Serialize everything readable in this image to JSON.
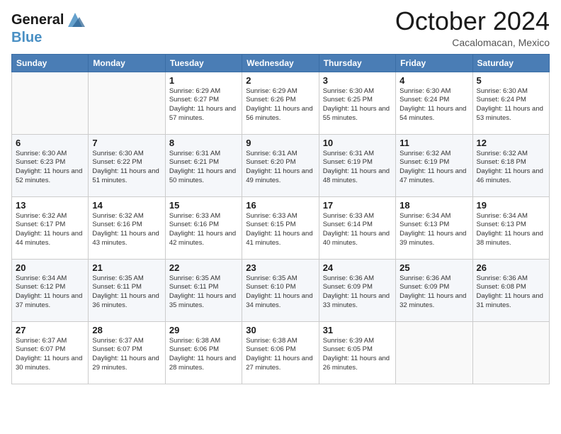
{
  "header": {
    "logo_line1": "General",
    "logo_line2": "Blue",
    "month": "October 2024",
    "location": "Cacalomacan, Mexico"
  },
  "weekdays": [
    "Sunday",
    "Monday",
    "Tuesday",
    "Wednesday",
    "Thursday",
    "Friday",
    "Saturday"
  ],
  "weeks": [
    [
      {
        "day": "",
        "info": ""
      },
      {
        "day": "",
        "info": ""
      },
      {
        "day": "1",
        "info": "Sunrise: 6:29 AM\nSunset: 6:27 PM\nDaylight: 11 hours and 57 minutes."
      },
      {
        "day": "2",
        "info": "Sunrise: 6:29 AM\nSunset: 6:26 PM\nDaylight: 11 hours and 56 minutes."
      },
      {
        "day": "3",
        "info": "Sunrise: 6:30 AM\nSunset: 6:25 PM\nDaylight: 11 hours and 55 minutes."
      },
      {
        "day": "4",
        "info": "Sunrise: 6:30 AM\nSunset: 6:24 PM\nDaylight: 11 hours and 54 minutes."
      },
      {
        "day": "5",
        "info": "Sunrise: 6:30 AM\nSunset: 6:24 PM\nDaylight: 11 hours and 53 minutes."
      }
    ],
    [
      {
        "day": "6",
        "info": "Sunrise: 6:30 AM\nSunset: 6:23 PM\nDaylight: 11 hours and 52 minutes."
      },
      {
        "day": "7",
        "info": "Sunrise: 6:30 AM\nSunset: 6:22 PM\nDaylight: 11 hours and 51 minutes."
      },
      {
        "day": "8",
        "info": "Sunrise: 6:31 AM\nSunset: 6:21 PM\nDaylight: 11 hours and 50 minutes."
      },
      {
        "day": "9",
        "info": "Sunrise: 6:31 AM\nSunset: 6:20 PM\nDaylight: 11 hours and 49 minutes."
      },
      {
        "day": "10",
        "info": "Sunrise: 6:31 AM\nSunset: 6:19 PM\nDaylight: 11 hours and 48 minutes."
      },
      {
        "day": "11",
        "info": "Sunrise: 6:32 AM\nSunset: 6:19 PM\nDaylight: 11 hours and 47 minutes."
      },
      {
        "day": "12",
        "info": "Sunrise: 6:32 AM\nSunset: 6:18 PM\nDaylight: 11 hours and 46 minutes."
      }
    ],
    [
      {
        "day": "13",
        "info": "Sunrise: 6:32 AM\nSunset: 6:17 PM\nDaylight: 11 hours and 44 minutes."
      },
      {
        "day": "14",
        "info": "Sunrise: 6:32 AM\nSunset: 6:16 PM\nDaylight: 11 hours and 43 minutes."
      },
      {
        "day": "15",
        "info": "Sunrise: 6:33 AM\nSunset: 6:16 PM\nDaylight: 11 hours and 42 minutes."
      },
      {
        "day": "16",
        "info": "Sunrise: 6:33 AM\nSunset: 6:15 PM\nDaylight: 11 hours and 41 minutes."
      },
      {
        "day": "17",
        "info": "Sunrise: 6:33 AM\nSunset: 6:14 PM\nDaylight: 11 hours and 40 minutes."
      },
      {
        "day": "18",
        "info": "Sunrise: 6:34 AM\nSunset: 6:13 PM\nDaylight: 11 hours and 39 minutes."
      },
      {
        "day": "19",
        "info": "Sunrise: 6:34 AM\nSunset: 6:13 PM\nDaylight: 11 hours and 38 minutes."
      }
    ],
    [
      {
        "day": "20",
        "info": "Sunrise: 6:34 AM\nSunset: 6:12 PM\nDaylight: 11 hours and 37 minutes."
      },
      {
        "day": "21",
        "info": "Sunrise: 6:35 AM\nSunset: 6:11 PM\nDaylight: 11 hours and 36 minutes."
      },
      {
        "day": "22",
        "info": "Sunrise: 6:35 AM\nSunset: 6:11 PM\nDaylight: 11 hours and 35 minutes."
      },
      {
        "day": "23",
        "info": "Sunrise: 6:35 AM\nSunset: 6:10 PM\nDaylight: 11 hours and 34 minutes."
      },
      {
        "day": "24",
        "info": "Sunrise: 6:36 AM\nSunset: 6:09 PM\nDaylight: 11 hours and 33 minutes."
      },
      {
        "day": "25",
        "info": "Sunrise: 6:36 AM\nSunset: 6:09 PM\nDaylight: 11 hours and 32 minutes."
      },
      {
        "day": "26",
        "info": "Sunrise: 6:36 AM\nSunset: 6:08 PM\nDaylight: 11 hours and 31 minutes."
      }
    ],
    [
      {
        "day": "27",
        "info": "Sunrise: 6:37 AM\nSunset: 6:07 PM\nDaylight: 11 hours and 30 minutes."
      },
      {
        "day": "28",
        "info": "Sunrise: 6:37 AM\nSunset: 6:07 PM\nDaylight: 11 hours and 29 minutes."
      },
      {
        "day": "29",
        "info": "Sunrise: 6:38 AM\nSunset: 6:06 PM\nDaylight: 11 hours and 28 minutes."
      },
      {
        "day": "30",
        "info": "Sunrise: 6:38 AM\nSunset: 6:06 PM\nDaylight: 11 hours and 27 minutes."
      },
      {
        "day": "31",
        "info": "Sunrise: 6:39 AM\nSunset: 6:05 PM\nDaylight: 11 hours and 26 minutes."
      },
      {
        "day": "",
        "info": ""
      },
      {
        "day": "",
        "info": ""
      }
    ]
  ]
}
